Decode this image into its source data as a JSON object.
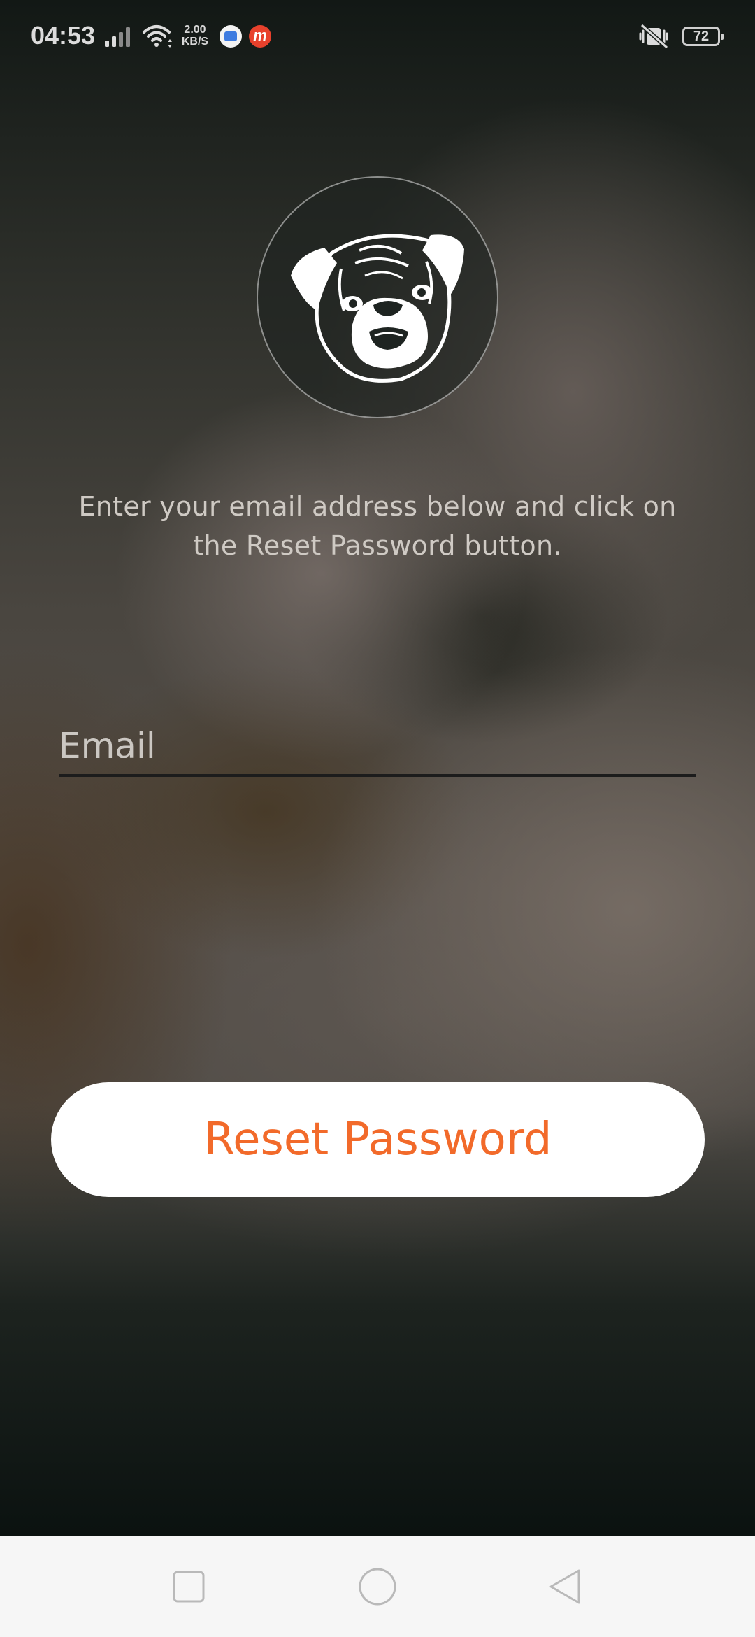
{
  "status_bar": {
    "time": "04:53",
    "net_speed_value": "2.00",
    "net_speed_unit": "KB/S",
    "battery_level": "72",
    "notification_icons": [
      "gboard-icon",
      "m-app-icon"
    ],
    "badge2_letter": "m"
  },
  "logo": {
    "icon": "pug-face-icon"
  },
  "instruction": {
    "text": "Enter your email address below and click on the Reset Password button."
  },
  "form": {
    "email_placeholder": "Email",
    "email_value": "",
    "reset_button_label": "Reset Password"
  },
  "colors": {
    "accent": "#f26a2a",
    "button_bg": "#ffffff",
    "nav_bar_bg": "#f6f6f6"
  },
  "nav_bar": {
    "buttons": [
      "recents-icon",
      "home-icon",
      "back-icon"
    ]
  }
}
